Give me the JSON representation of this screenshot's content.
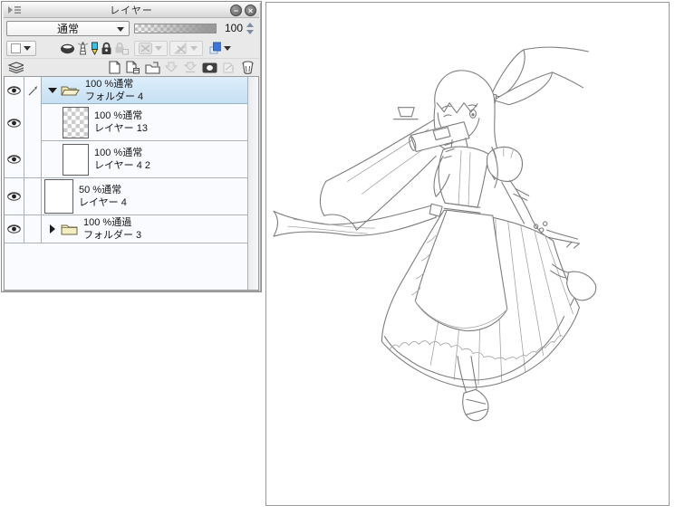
{
  "layers_panel": {
    "title": "レイヤー",
    "titlebar_buttons": [
      {
        "name": "minimize",
        "glyph": "−"
      },
      {
        "name": "close",
        "glyph": "×"
      }
    ],
    "blend_mode": {
      "selected": "通常"
    },
    "opacity": {
      "value": "100"
    },
    "property_icons": [
      "palette-color-dropdown",
      "clip-to-layer-below",
      "set-as-reference-layer",
      "set-as-draft-layer",
      "lock-layer",
      "lock-transparent-pixels",
      "enable-layer-mask",
      "set-ruler-range",
      "layer-color"
    ],
    "command_icons": [
      "layer-list-options",
      "new-raster-layer",
      "new-vector-layer",
      "new-layer-folder",
      "transfer-to-lower-layer",
      "merge-with-lower-layer",
      "create-layer-mask",
      "apply-mask-to-layer",
      "delete-layer"
    ],
    "selected_row_color": "#cde4f5",
    "layer_color_chip": "#3d76d9",
    "layers": [
      {
        "opacity_blend": "100 %通常",
        "name": "フォルダー 4",
        "kind": "folder",
        "state": "expanded",
        "selected": true,
        "visible": true,
        "editing": true
      },
      {
        "opacity_blend": "100 %通常",
        "name": "レイヤー 13",
        "kind": "raster",
        "thumb": "transparent-checker",
        "visible": true,
        "nested": true
      },
      {
        "opacity_blend": "100 %通常",
        "name": "レイヤー 4 2",
        "kind": "raster",
        "thumb": "white",
        "visible": true,
        "nested": true
      },
      {
        "opacity_blend": "50 %通常",
        "name": "レイヤー 4",
        "kind": "raster",
        "thumb": "white",
        "visible": true,
        "nested": false
      },
      {
        "opacity_blend": "100 %通過",
        "name": "フォルダー 3",
        "kind": "folder",
        "state": "collapsed",
        "visible": true,
        "nested": false
      }
    ]
  },
  "canvas": {
    "content": "pencil line-art sketch of a winking girl with a large hair ribbon, puffy short-sleeved blouse, long frilled skirt and sash, jumping with one leg bent"
  }
}
